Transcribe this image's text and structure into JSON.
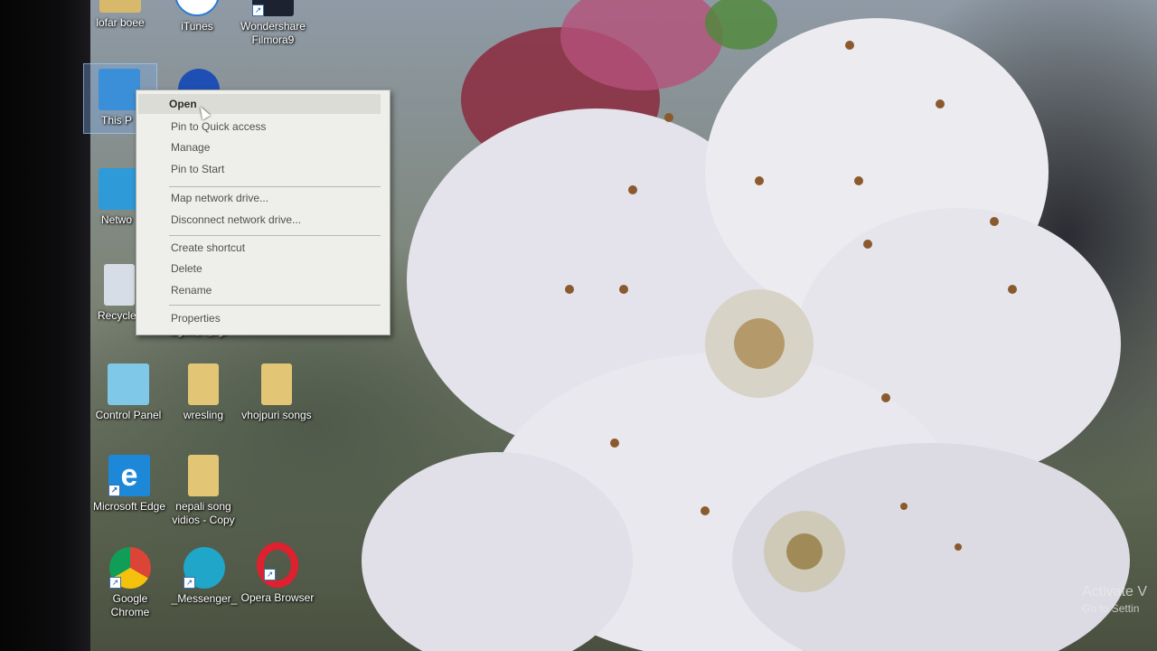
{
  "desktop": {
    "icons": [
      {
        "label": "lofar boee",
        "icon": "folder-icon"
      },
      {
        "label": "iTunes",
        "icon": "itunes-icon"
      },
      {
        "label": "Wondershare Filmora9",
        "icon": "filmora-icon"
      },
      {
        "label": "This P",
        "icon": "this-pc-icon"
      },
      {
        "label": "Netwo",
        "icon": "network-icon"
      },
      {
        "label": "Recycle",
        "icon": "recycle-bin-icon"
      },
      {
        "label": "Control Panel",
        "icon": "control-panel-icon"
      },
      {
        "label": "wresling",
        "icon": "folder-icon"
      },
      {
        "label": "vhojpuri songs",
        "icon": "folder-icon"
      },
      {
        "label": "Microsoft Edge",
        "icon": "edge-icon"
      },
      {
        "label": "nepali song vidios - Copy",
        "icon": "folder-icon"
      },
      {
        "label": "Google Chrome",
        "icon": "chrome-icon"
      },
      {
        "label": "_Messenger_",
        "icon": "messenger-icon"
      },
      {
        "label": "Opera Browser",
        "icon": "opera-icon"
      }
    ],
    "partial_label_under_menu": "ترکی فیسبوک"
  },
  "context_menu": {
    "items": [
      {
        "label": "Open",
        "default": true,
        "highlighted": true
      },
      {
        "label": "Pin to Quick access"
      },
      {
        "label": "Manage"
      },
      {
        "label": "Pin to Start"
      },
      {
        "label": "Map network drive..."
      },
      {
        "label": "Disconnect network drive..."
      },
      {
        "label": "Create shortcut"
      },
      {
        "label": "Delete"
      },
      {
        "label": "Rename"
      },
      {
        "label": "Properties"
      }
    ]
  },
  "watermark": {
    "line1": "Activate V",
    "line2": "Go to Settin"
  },
  "colors": {
    "menu_bg": "#eeeeea",
    "menu_highlight": "#dcdcd6",
    "edge_blue": "#1e88d8",
    "opera_red": "#e0202e",
    "messenger_teal": "#1fa6c9"
  }
}
